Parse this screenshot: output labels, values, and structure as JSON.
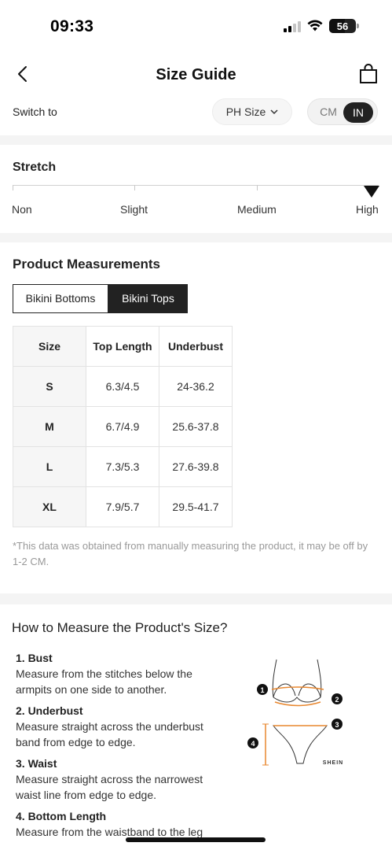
{
  "status_bar": {
    "time": "09:33",
    "battery_level": "56",
    "icons": [
      "signal-icon",
      "wifi-icon",
      "battery-icon"
    ]
  },
  "header": {
    "title": "Size Guide",
    "icons": [
      "back-arrow-icon",
      "shopping-bag-icon"
    ]
  },
  "switch": {
    "label": "Switch to",
    "size_system": "PH Size",
    "units": [
      "CM",
      "IN"
    ],
    "selected_unit": "IN"
  },
  "stretch": {
    "title": "Stretch",
    "levels": [
      "Non",
      "Slight",
      "Medium",
      "High"
    ],
    "selected_level": "High"
  },
  "product_measurements": {
    "title": "Product Measurements",
    "tabs": [
      "Bikini Bottoms",
      "Bikini Tops"
    ],
    "active_tab": "Bikini Tops",
    "table": {
      "headers": [
        "Size",
        "Top Length",
        "Underbust"
      ],
      "rows": [
        [
          "S",
          "6.3/4.5",
          "24-36.2"
        ],
        [
          "M",
          "6.7/4.9",
          "25.6-37.8"
        ],
        [
          "L",
          "7.3/5.3",
          "27.6-39.8"
        ],
        [
          "XL",
          "7.9/5.7",
          "29.5-41.7"
        ]
      ]
    },
    "disclaimer": "*This data was obtained from manually measuring the product, it may be off by 1-2 CM."
  },
  "how_to_measure": {
    "title": "How to Measure the Product's Size?",
    "steps": [
      {
        "title": "1. Bust",
        "text": "Measure from the stitches below the armpits on one side to another."
      },
      {
        "title": "2. Underbust",
        "text": "Measure straight across the underbust band from edge to edge."
      },
      {
        "title": "3. Waist",
        "text": "Measure straight across the narrowest waist line from edge to edge."
      },
      {
        "title": "4. Bottom Length",
        "text": "Measure from the waistband to the leg"
      }
    ],
    "illustration": {
      "markers": [
        "1",
        "2",
        "3",
        "4"
      ],
      "brand": "SHEIN",
      "accent_color": "#e8872f"
    }
  }
}
